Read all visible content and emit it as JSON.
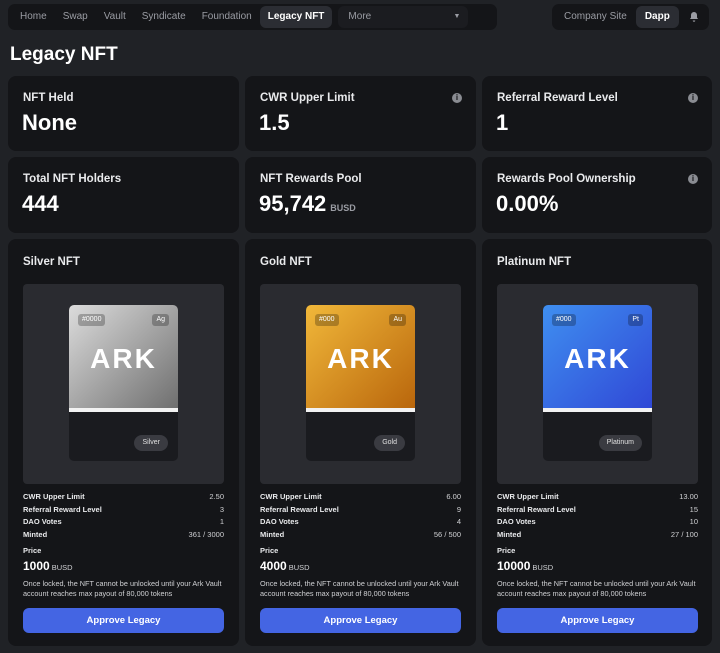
{
  "nav": {
    "items": [
      "Home",
      "Swap",
      "Vault",
      "Syndicate",
      "Foundation",
      "Legacy NFT"
    ],
    "active": "Legacy NFT",
    "more_label": "More",
    "company_site": "Company Site",
    "dapp": "Dapp"
  },
  "page": {
    "title": "Legacy NFT"
  },
  "stats": [
    {
      "label": "NFT Held",
      "value": "None",
      "info": false
    },
    {
      "label": "CWR Upper Limit",
      "value": "1.5",
      "info": true
    },
    {
      "label": "Referral Reward Level",
      "value": "1",
      "info": true
    },
    {
      "label": "Total NFT Holders",
      "value": "444",
      "info": false
    },
    {
      "label": "NFT Rewards Pool",
      "value": "95,742",
      "unit": "BUSD",
      "info": false
    },
    {
      "label": "Rewards Pool Ownership",
      "value": "0.00%",
      "info": true
    }
  ],
  "nfts": [
    {
      "title": "Silver NFT",
      "id_tag": "#0000",
      "symbol": "Ag",
      "logo": "ARK",
      "tier": "Silver",
      "gradient": [
        "#dcdcdc",
        "#6f6f6f"
      ],
      "details": [
        {
          "k": "CWR Upper Limit",
          "v": "2.50"
        },
        {
          "k": "Referral Reward Level",
          "v": "3"
        },
        {
          "k": "DAO Votes",
          "v": "1"
        },
        {
          "k": "Minted",
          "v": "361 / 3000"
        }
      ],
      "price_label": "Price",
      "price": "1000",
      "price_unit": "BUSD",
      "note": "Once locked, the NFT cannot be unlocked until your Ark Vault account reaches max payout of 80,000 tokens",
      "button": "Approve Legacy"
    },
    {
      "title": "Gold NFT",
      "id_tag": "#000",
      "symbol": "Au",
      "logo": "ARK",
      "tier": "Gold",
      "gradient": [
        "#f1b83a",
        "#b9660c"
      ],
      "details": [
        {
          "k": "CWR Upper Limit",
          "v": "6.00"
        },
        {
          "k": "Referral Reward Level",
          "v": "9"
        },
        {
          "k": "DAO Votes",
          "v": "4"
        },
        {
          "k": "Minted",
          "v": "56 / 500"
        }
      ],
      "price_label": "Price",
      "price": "4000",
      "price_unit": "BUSD",
      "note": "Once locked, the NFT cannot be unlocked until your Ark Vault account reaches max payout of 80,000 tokens",
      "button": "Approve Legacy"
    },
    {
      "title": "Platinum NFT",
      "id_tag": "#000",
      "symbol": "Pt",
      "logo": "ARK",
      "tier": "Platinum",
      "gradient": [
        "#3f8ff0",
        "#3048d6"
      ],
      "details": [
        {
          "k": "CWR Upper Limit",
          "v": "13.00"
        },
        {
          "k": "Referral Reward Level",
          "v": "15"
        },
        {
          "k": "DAO Votes",
          "v": "10"
        },
        {
          "k": "Minted",
          "v": "27 / 100"
        }
      ],
      "price_label": "Price",
      "price": "10000",
      "price_unit": "BUSD",
      "note": "Once locked, the NFT cannot be unlocked until your Ark Vault account reaches max payout of 80,000 tokens",
      "button": "Approve Legacy"
    }
  ],
  "colors": {
    "accent": "#4465e3",
    "card": "#141518",
    "background": "#202226"
  },
  "icons": {
    "bell": "bell-icon",
    "info": "info-icon",
    "chevron": "chevron-down-icon"
  }
}
